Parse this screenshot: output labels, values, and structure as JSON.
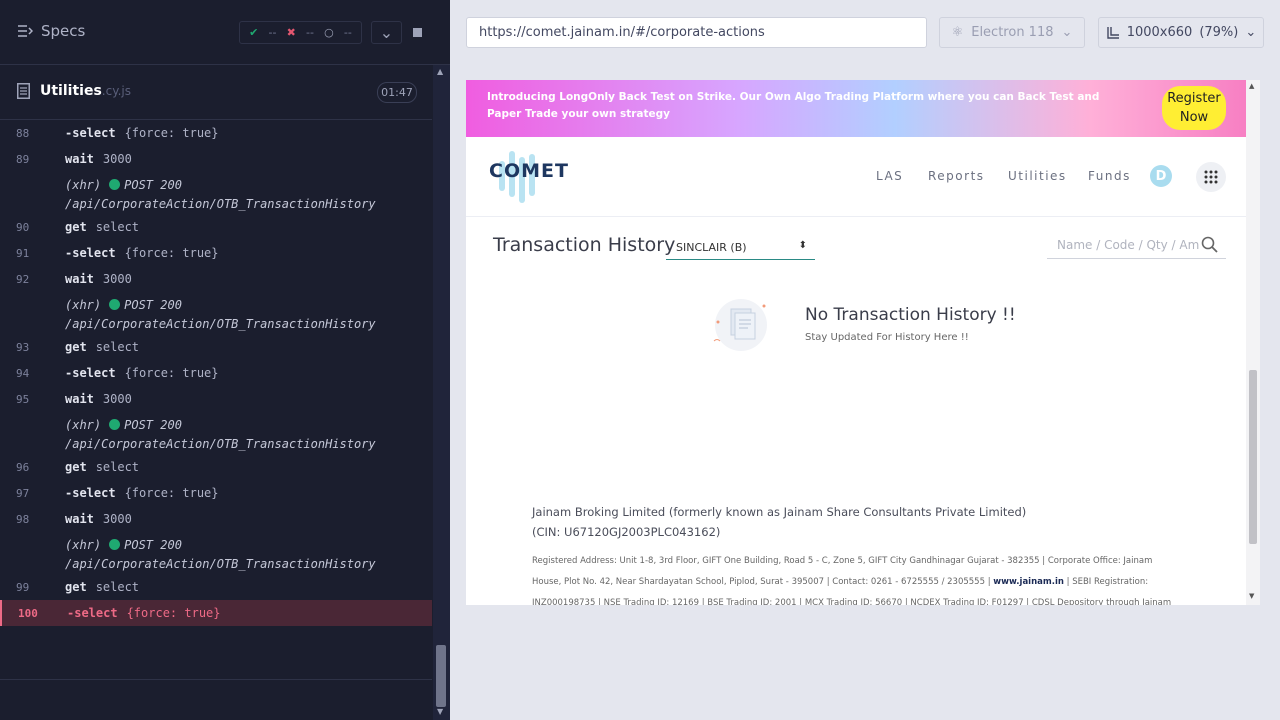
{
  "runner": {
    "specs_label": "Specs",
    "stats": {
      "passed": "--",
      "failed": "--",
      "pending": "--"
    },
    "file": {
      "name": "Utilities",
      "ext": ".cy.js",
      "duration": "01:47"
    },
    "commands": [
      {
        "num": "88",
        "name": "-select",
        "msg": "{force: true}"
      },
      {
        "num": "89",
        "name": "wait",
        "msg": "3000"
      },
      {
        "sub": true,
        "line1": "(xhr)",
        "status": "POST 200",
        "line2": "/api/CorporateAction/OTB_TransactionHistory"
      },
      {
        "num": "90",
        "name": "get",
        "msg": "select"
      },
      {
        "num": "91",
        "name": "-select",
        "msg": "{force: true}"
      },
      {
        "num": "92",
        "name": "wait",
        "msg": "3000"
      },
      {
        "sub": true,
        "line1": "(xhr)",
        "status": "POST 200",
        "line2": "/api/CorporateAction/OTB_TransactionHistory"
      },
      {
        "num": "93",
        "name": "get",
        "msg": "select"
      },
      {
        "num": "94",
        "name": "-select",
        "msg": "{force: true}"
      },
      {
        "num": "95",
        "name": "wait",
        "msg": "3000"
      },
      {
        "sub": true,
        "line1": "(xhr)",
        "status": "POST 200",
        "line2": "/api/CorporateAction/OTB_TransactionHistory"
      },
      {
        "num": "96",
        "name": "get",
        "msg": "select"
      },
      {
        "num": "97",
        "name": "-select",
        "msg": "{force: true}"
      },
      {
        "num": "98",
        "name": "wait",
        "msg": "3000"
      },
      {
        "sub": true,
        "line1": "(xhr)",
        "status": "POST 200",
        "line2": "/api/CorporateAction/OTB_TransactionHistory"
      },
      {
        "num": "99",
        "name": "get",
        "msg": "select"
      },
      {
        "num": "100",
        "name": "-select",
        "msg": "{force: true}",
        "active": true
      }
    ]
  },
  "browser": {
    "url": "https://comet.jainam.in/#/corporate-actions",
    "engine": "Electron 118",
    "viewport": "1000x660",
    "zoom": "(79%)"
  },
  "app": {
    "banner_text": "Introducing LongOnly Back Test on Strike. Our Own Algo Trading Platform where you can Back Test and Paper Trade your own strategy",
    "register_label": "Register Now",
    "logo": "COMET",
    "nav": [
      "LAS",
      "Reports",
      "Utilities",
      "Funds"
    ],
    "avatar_letter": "D",
    "page_title": "Transaction History",
    "selected_client": "SINCLAIR (B)",
    "search_placeholder": "Name / Code / Qty / Am",
    "empty_title": "No Transaction History !!",
    "empty_sub": "Stay Updated For History Here !!",
    "footer_title": "Jainam Broking Limited (formerly known as Jainam Share Consultants Private Limited)(CIN: U67120GJ2003PLC043162)",
    "footer_addr_a": "Registered Address: Unit 1-8, 3rd Floor, GIFT One Building, Road 5 - C, Zone 5, GIFT City Gandhinagar Gujarat - 382355 | Corporate Office: Jainam House, Plot No. 42, Near Shardayatan School, Piplod, Surat - 395007 | Contact: 0261 - 6725555 / 2305555 |",
    "footer_link": "www.jainam.in",
    "footer_addr_b": "| SEBI Registration: INZ000198735 | NSE Trading ID: 12169 | BSE Trading ID: 2001 | MCX Trading ID: 56670 | NCDEX Trading ID: F01297 | CDSL Depository through Jainam"
  },
  "colors": {
    "accent_pass": "#1fa971",
    "accent_fail": "#e45770",
    "active_row": "#ee6a86"
  }
}
